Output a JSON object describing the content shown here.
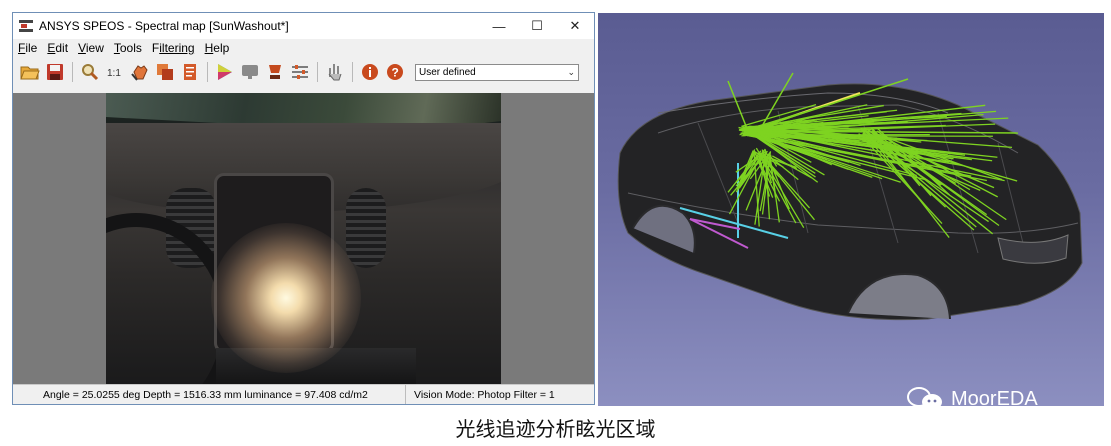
{
  "window": {
    "title": "ANSYS SPEOS - Spectral map [SunWashout*]",
    "controls": {
      "minimize": "—",
      "maximize": "☐",
      "close": "✕"
    }
  },
  "menu": {
    "items": [
      {
        "underline": "F",
        "rest": "ile"
      },
      {
        "underline": "E",
        "rest": "dit"
      },
      {
        "underline": "V",
        "rest": "iew"
      },
      {
        "underline": "T",
        "rest": "ools"
      },
      {
        "underline": "F",
        "rest": "iltering"
      },
      {
        "underline": "H",
        "rest": "elp"
      }
    ]
  },
  "toolbar": {
    "icons": [
      "open-folder-icon",
      "save-icon",
      "zoom-icon",
      "actual-size-icon",
      "hand-pan-icon",
      "layers-icon",
      "document-icon",
      "color-palette-icon",
      "monitor-icon",
      "lamp-icon",
      "sliders-icon",
      "pointer-tool-icon",
      "info-icon",
      "help-icon"
    ],
    "dropdown_value": "User defined"
  },
  "status": {
    "left": "Angle = 25.0255 deg  Depth = 1516.33 mm  luminance = 97.408 cd/m2",
    "right": "Vision Mode: Photop  Filter = 1"
  },
  "watermark": {
    "text": "MoorEDA"
  },
  "caption": "光线追迹分析眩光区域",
  "colors": {
    "ray": "#7ed321",
    "ray_yellow": "#f2e45c",
    "cad_bg_top": "#5a5c92",
    "cad_bg_bottom": "#8c8fc0",
    "axis_cyan": "#58d0e6",
    "axis_magenta": "#c05ad0"
  }
}
